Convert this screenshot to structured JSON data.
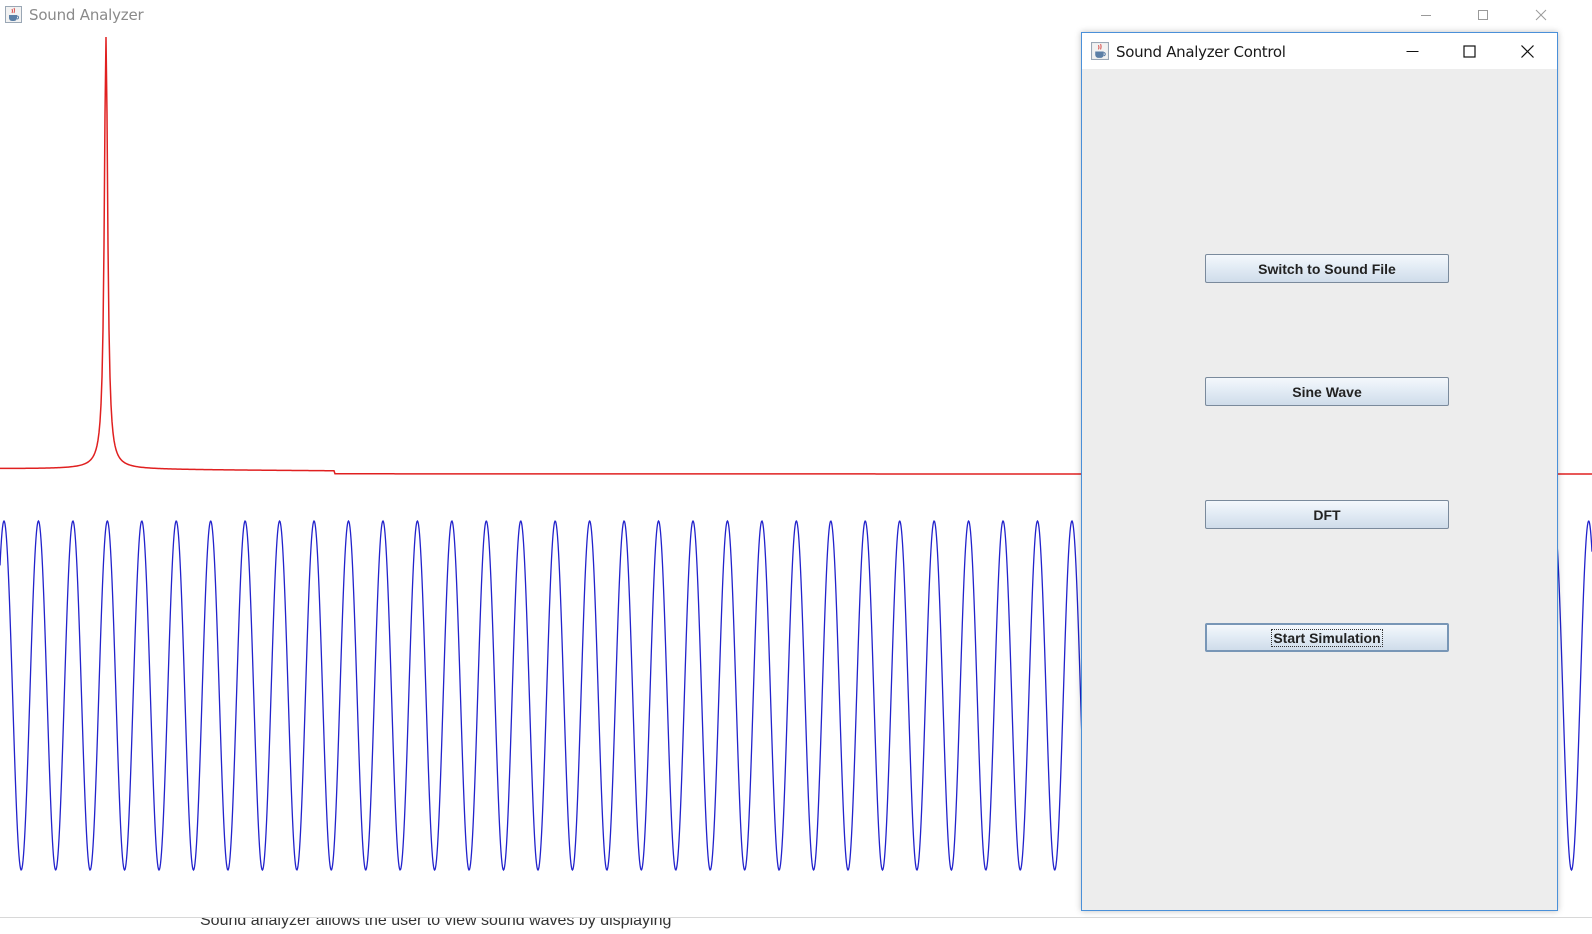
{
  "main_window": {
    "title": "Sound Analyzer",
    "icon": "java-cup-icon",
    "controls": [
      "minimize-icon",
      "maximize-icon",
      "close-icon"
    ]
  },
  "plot": {
    "spectrum_color": "#e02020",
    "waveform_color": "#2222cc",
    "waveform_cycles_visible": 45
  },
  "status_text": "Sound analyzer allows the user to view sound waves by displaying",
  "control_window": {
    "title": "Sound Analyzer Control",
    "icon": "java-cup-icon",
    "buttons": {
      "switch": "Switch to Sound File",
      "sine": "Sine Wave",
      "dft": "DFT",
      "start": "Start Simulation"
    }
  },
  "colors": {
    "window_border": "#4a90d9",
    "panel_background": "#ededed"
  }
}
